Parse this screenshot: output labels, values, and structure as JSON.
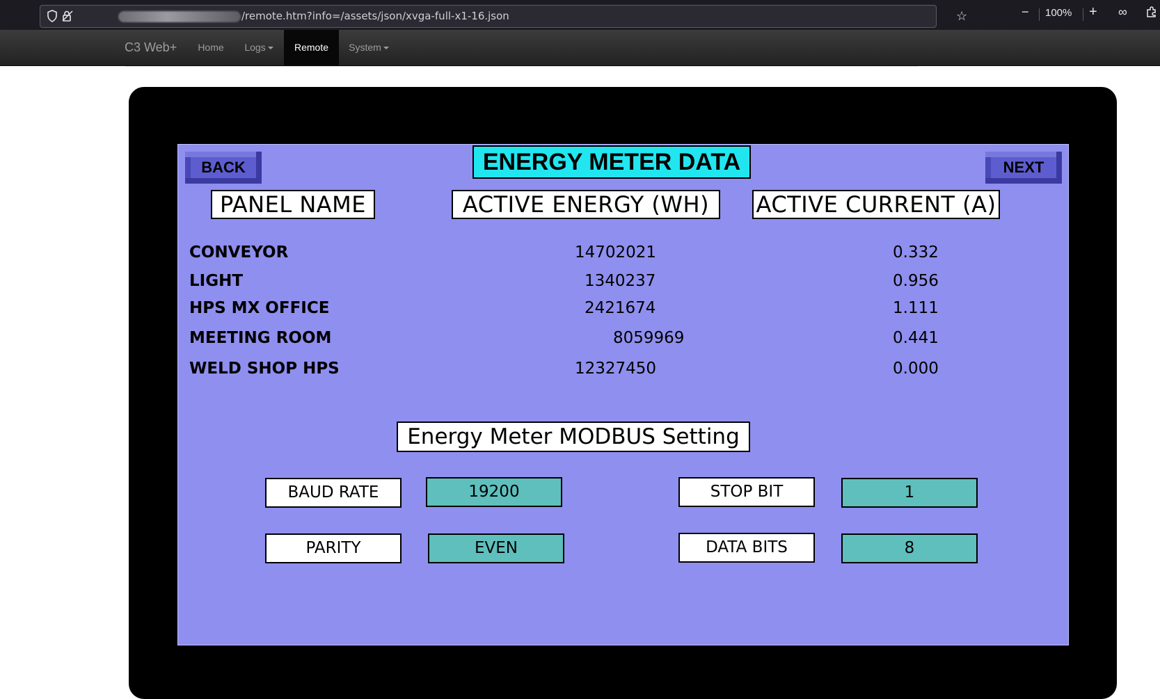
{
  "browser": {
    "url_path": "/remote.htm?info=/assets/json/xvga-full-x1-16.json",
    "zoom": "100%"
  },
  "navbar": {
    "brand": "C3 Web+",
    "items": [
      {
        "label": "Home"
      },
      {
        "label": "Logs"
      },
      {
        "label": "Remote"
      },
      {
        "label": "System"
      }
    ]
  },
  "hmi": {
    "back_label": "BACK",
    "next_label": "NEXT",
    "title": "ENERGY METER DATA",
    "headers": {
      "panel_name": "PANEL NAME",
      "active_energy": "ACTIVE ENERGY (WH)",
      "active_current": "ACTIVE CURRENT (A)"
    },
    "rows": [
      {
        "name": "CONVEYOR",
        "energy": "14702021",
        "current": "0.332"
      },
      {
        "name": "LIGHT",
        "energy": "1340237",
        "current": "0.956"
      },
      {
        "name": "HPS MX OFFICE",
        "energy": "2421674",
        "current": "1.111"
      },
      {
        "name": "MEETING ROOM",
        "energy": "8059969",
        "current": "0.441"
      },
      {
        "name": "WELD SHOP HPS",
        "energy": "12327450",
        "current": "0.000"
      }
    ],
    "modbus": {
      "title": "Energy Meter MODBUS Setting",
      "baud_rate_label": "BAUD RATE",
      "baud_rate_value": "19200",
      "stop_bit_label": "STOP BIT",
      "stop_bit_value": "1",
      "parity_label": "PARITY",
      "parity_value": "EVEN",
      "data_bits_label": "DATA BITS",
      "data_bits_value": "8"
    }
  }
}
